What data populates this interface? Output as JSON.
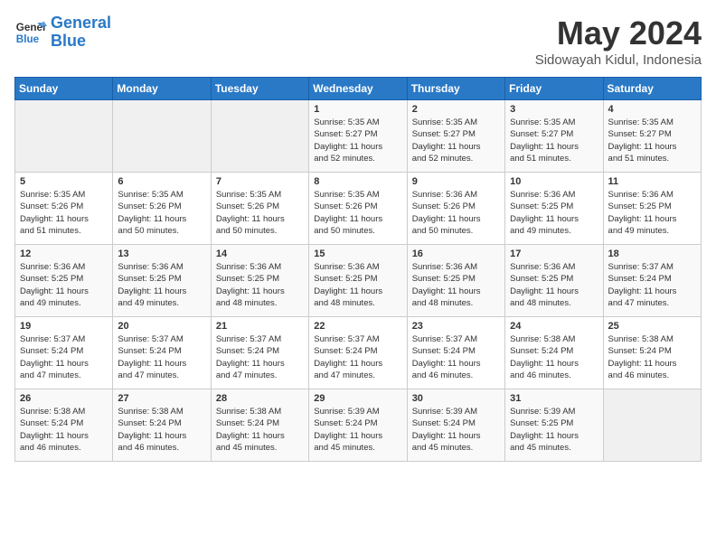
{
  "header": {
    "logo_line1": "General",
    "logo_line2": "Blue",
    "month": "May 2024",
    "location": "Sidowayah Kidul, Indonesia"
  },
  "weekdays": [
    "Sunday",
    "Monday",
    "Tuesday",
    "Wednesday",
    "Thursday",
    "Friday",
    "Saturday"
  ],
  "weeks": [
    [
      {
        "day": "",
        "info": ""
      },
      {
        "day": "",
        "info": ""
      },
      {
        "day": "",
        "info": ""
      },
      {
        "day": "1",
        "info": "Sunrise: 5:35 AM\nSunset: 5:27 PM\nDaylight: 11 hours\nand 52 minutes."
      },
      {
        "day": "2",
        "info": "Sunrise: 5:35 AM\nSunset: 5:27 PM\nDaylight: 11 hours\nand 52 minutes."
      },
      {
        "day": "3",
        "info": "Sunrise: 5:35 AM\nSunset: 5:27 PM\nDaylight: 11 hours\nand 51 minutes."
      },
      {
        "day": "4",
        "info": "Sunrise: 5:35 AM\nSunset: 5:27 PM\nDaylight: 11 hours\nand 51 minutes."
      }
    ],
    [
      {
        "day": "5",
        "info": "Sunrise: 5:35 AM\nSunset: 5:26 PM\nDaylight: 11 hours\nand 51 minutes."
      },
      {
        "day": "6",
        "info": "Sunrise: 5:35 AM\nSunset: 5:26 PM\nDaylight: 11 hours\nand 50 minutes."
      },
      {
        "day": "7",
        "info": "Sunrise: 5:35 AM\nSunset: 5:26 PM\nDaylight: 11 hours\nand 50 minutes."
      },
      {
        "day": "8",
        "info": "Sunrise: 5:35 AM\nSunset: 5:26 PM\nDaylight: 11 hours\nand 50 minutes."
      },
      {
        "day": "9",
        "info": "Sunrise: 5:36 AM\nSunset: 5:26 PM\nDaylight: 11 hours\nand 50 minutes."
      },
      {
        "day": "10",
        "info": "Sunrise: 5:36 AM\nSunset: 5:25 PM\nDaylight: 11 hours\nand 49 minutes."
      },
      {
        "day": "11",
        "info": "Sunrise: 5:36 AM\nSunset: 5:25 PM\nDaylight: 11 hours\nand 49 minutes."
      }
    ],
    [
      {
        "day": "12",
        "info": "Sunrise: 5:36 AM\nSunset: 5:25 PM\nDaylight: 11 hours\nand 49 minutes."
      },
      {
        "day": "13",
        "info": "Sunrise: 5:36 AM\nSunset: 5:25 PM\nDaylight: 11 hours\nand 49 minutes."
      },
      {
        "day": "14",
        "info": "Sunrise: 5:36 AM\nSunset: 5:25 PM\nDaylight: 11 hours\nand 48 minutes."
      },
      {
        "day": "15",
        "info": "Sunrise: 5:36 AM\nSunset: 5:25 PM\nDaylight: 11 hours\nand 48 minutes."
      },
      {
        "day": "16",
        "info": "Sunrise: 5:36 AM\nSunset: 5:25 PM\nDaylight: 11 hours\nand 48 minutes."
      },
      {
        "day": "17",
        "info": "Sunrise: 5:36 AM\nSunset: 5:25 PM\nDaylight: 11 hours\nand 48 minutes."
      },
      {
        "day": "18",
        "info": "Sunrise: 5:37 AM\nSunset: 5:24 PM\nDaylight: 11 hours\nand 47 minutes."
      }
    ],
    [
      {
        "day": "19",
        "info": "Sunrise: 5:37 AM\nSunset: 5:24 PM\nDaylight: 11 hours\nand 47 minutes."
      },
      {
        "day": "20",
        "info": "Sunrise: 5:37 AM\nSunset: 5:24 PM\nDaylight: 11 hours\nand 47 minutes."
      },
      {
        "day": "21",
        "info": "Sunrise: 5:37 AM\nSunset: 5:24 PM\nDaylight: 11 hours\nand 47 minutes."
      },
      {
        "day": "22",
        "info": "Sunrise: 5:37 AM\nSunset: 5:24 PM\nDaylight: 11 hours\nand 47 minutes."
      },
      {
        "day": "23",
        "info": "Sunrise: 5:37 AM\nSunset: 5:24 PM\nDaylight: 11 hours\nand 46 minutes."
      },
      {
        "day": "24",
        "info": "Sunrise: 5:38 AM\nSunset: 5:24 PM\nDaylight: 11 hours\nand 46 minutes."
      },
      {
        "day": "25",
        "info": "Sunrise: 5:38 AM\nSunset: 5:24 PM\nDaylight: 11 hours\nand 46 minutes."
      }
    ],
    [
      {
        "day": "26",
        "info": "Sunrise: 5:38 AM\nSunset: 5:24 PM\nDaylight: 11 hours\nand 46 minutes."
      },
      {
        "day": "27",
        "info": "Sunrise: 5:38 AM\nSunset: 5:24 PM\nDaylight: 11 hours\nand 46 minutes."
      },
      {
        "day": "28",
        "info": "Sunrise: 5:38 AM\nSunset: 5:24 PM\nDaylight: 11 hours\nand 45 minutes."
      },
      {
        "day": "29",
        "info": "Sunrise: 5:39 AM\nSunset: 5:24 PM\nDaylight: 11 hours\nand 45 minutes."
      },
      {
        "day": "30",
        "info": "Sunrise: 5:39 AM\nSunset: 5:24 PM\nDaylight: 11 hours\nand 45 minutes."
      },
      {
        "day": "31",
        "info": "Sunrise: 5:39 AM\nSunset: 5:25 PM\nDaylight: 11 hours\nand 45 minutes."
      },
      {
        "day": "",
        "info": ""
      }
    ]
  ]
}
